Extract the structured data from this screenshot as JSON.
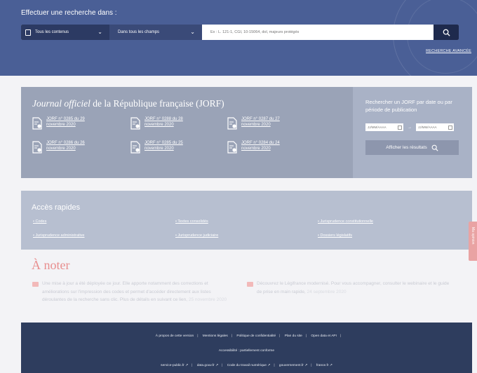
{
  "header": {
    "title": "Effectuer une recherche dans :",
    "scope_select": "Tous les contenus",
    "field_select": "Dans tous les champs",
    "search_placeholder": "Ex : L. 121-1, CGI, 10-15064, dol, majeurs protégés",
    "advanced_link": "RECHERCHE AVANCÉE"
  },
  "jorf": {
    "title_italic": "Journal officiel",
    "title_rest": " de la République française (JORF)",
    "items": [
      {
        "line1": "JORF n° 0285 du 29",
        "line2": "novembre 2020"
      },
      {
        "line1": "JORF n° 0288 du 28",
        "line2": "novembre 2020"
      },
      {
        "line1": "JORF n° 0287 du 27",
        "line2": "novembre 2020"
      },
      {
        "line1": "JORF n° 0286 du 26",
        "line2": "novembre 2020"
      },
      {
        "line1": "JORF n° 0285 du 25",
        "line2": "novembre 2020"
      },
      {
        "line1": "JORF n° 0284 du 24",
        "line2": "novembre 2020"
      }
    ]
  },
  "date_search": {
    "title": "Rechercher un JORF par date ou par période de publication",
    "from_placeholder": "JJ/MM/AAAA",
    "to_placeholder": "JJ/MM/AAAA",
    "button": "Afficher les résultats"
  },
  "quick_access": {
    "title": "Accès rapides",
    "links": [
      "Codes",
      "Textes consolidés",
      "Jurisprudence constitutionnelle",
      "Jurisprudence administrative",
      "Jurisprudence judiciaire",
      "Dossiers législatifs"
    ]
  },
  "side_tab": "Ma opinion",
  "notes": {
    "title": "À noter",
    "left_text": "Une mise à jour a été déployée ce jour. Elle apporte notamment des corrections et améliorations sur l'impression des codes et permet d'accéder directement aux listes déroulantes de la recherche sans clic. Plus de détails en suivant ce lien,",
    "left_date": " 25 novembre 2020",
    "right_text": "Découvrez le Légifrance modernisé. Pour vous accompagner, consulter le webinaire et le guide de prise en main rapide,",
    "right_date": " 24 septembre 2020"
  },
  "footer": {
    "row1": [
      "À propos de cette version",
      "Mentions légales",
      "Politique de confidentialité",
      "Plan du site",
      "Open data et API"
    ],
    "row2": "Accessibilité : partiellement conforme",
    "row3": [
      "service-public.fr",
      "data.gouv.fr",
      "Code du travail numérique",
      "gouvernement.fr",
      "france.fr"
    ]
  },
  "colors": {
    "header_bg": "#4a5f96",
    "jorf_bg": "#9aa3b7",
    "quick_bg": "#b7bfd0",
    "note_accent": "#e88e8e",
    "footer_bg": "#2e3d5e"
  }
}
